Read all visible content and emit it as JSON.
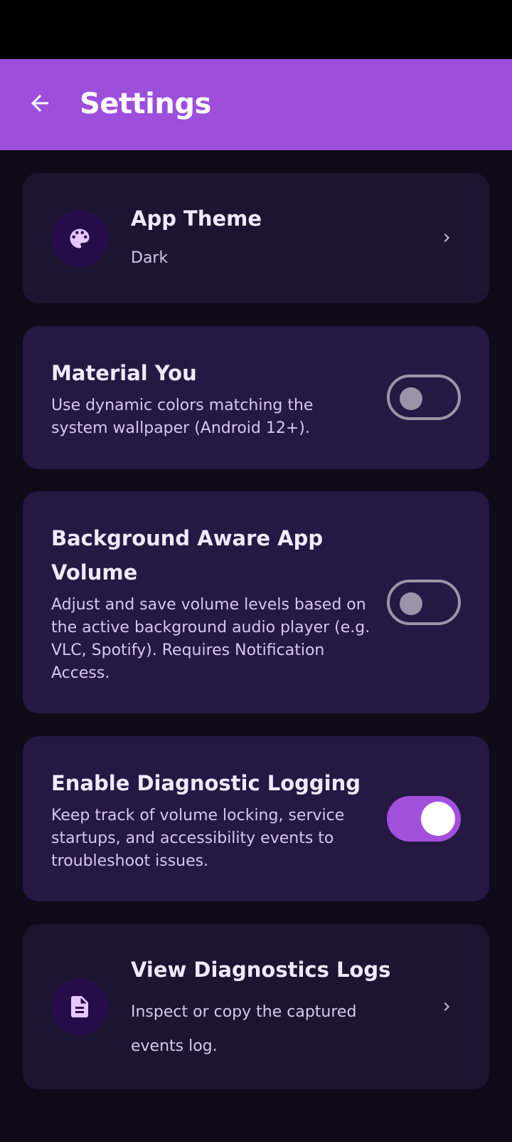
{
  "appbar": {
    "title": "Settings",
    "back_icon": "arrow-left-icon"
  },
  "colors": {
    "accent": "#9d4fdc",
    "background": "#0f0a18",
    "card": "#251843"
  },
  "settings": {
    "theme": {
      "title": "App Theme",
      "value": "Dark",
      "icon": "palette-icon"
    },
    "material_you": {
      "title": "Material You",
      "subtitle": "Use dynamic colors matching the system wallpaper (Android 12+).",
      "enabled": false
    },
    "background_aware": {
      "title": "Background Aware App Volume",
      "subtitle": "Adjust and save volume levels based on the active background audio player (e.g. VLC, Spotify). Requires Notification Access.",
      "enabled": false
    },
    "diagnostic_logging": {
      "title": "Enable Diagnostic Logging",
      "subtitle": "Keep track of volume locking, service startups, and accessibility events to troubleshoot issues.",
      "enabled": true
    },
    "view_logs": {
      "title": "View Diagnostics Logs",
      "subtitle": "Inspect or copy the captured events log.",
      "icon": "document-icon"
    }
  }
}
